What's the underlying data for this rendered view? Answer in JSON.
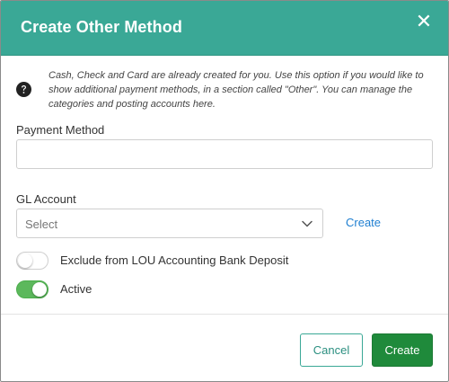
{
  "dialog": {
    "title": "Create Other Method",
    "close_glyph": "✕"
  },
  "info": {
    "icon": "question-circle-icon",
    "text": "Cash, Check and Card are already created for you. Use this option if you would like to show additional payment methods, in a section called \"Other\". You can manage the categories and posting accounts here."
  },
  "form": {
    "payment_method": {
      "label": "Payment Method",
      "value": "",
      "placeholder": ""
    },
    "gl_account": {
      "label": "GL Account",
      "selected": "Select",
      "create_link": "Create"
    },
    "exclude_toggle": {
      "label": "Exclude from LOU Accounting Bank Deposit",
      "checked": false
    },
    "active_toggle": {
      "label": "Active",
      "checked": true
    }
  },
  "footer": {
    "cancel_label": "Cancel",
    "create_label": "Create"
  },
  "colors": {
    "header": "#3aa896",
    "primary_button": "#1f8a3b",
    "toggle_on": "#5cb85c",
    "link": "#1f7fd1"
  }
}
